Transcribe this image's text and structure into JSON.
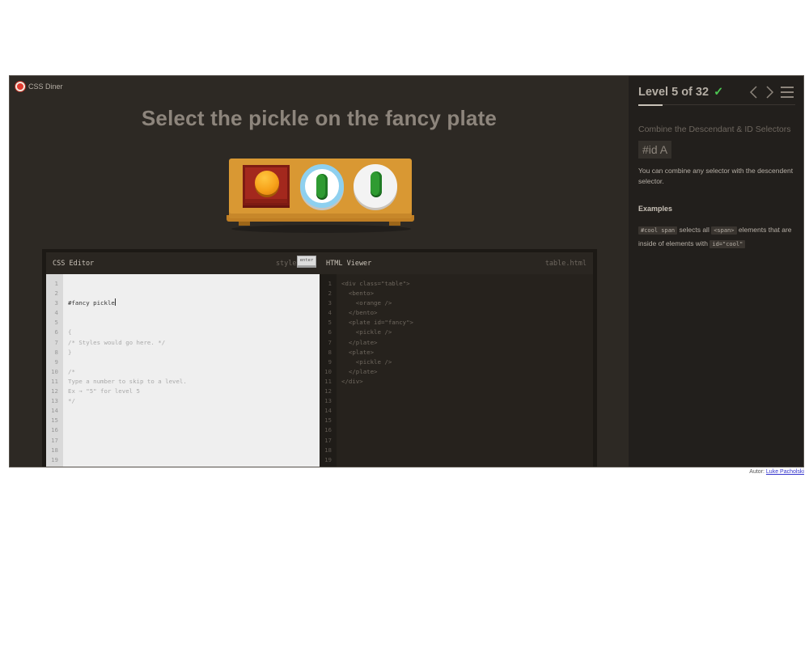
{
  "app": {
    "name": "CSS Diner"
  },
  "order": "Select the pickle on the fancy plate",
  "editor": {
    "css": {
      "title": "CSS Editor",
      "file": "style.css",
      "input": "#fancy pickle",
      "enter_label": "enter",
      "lines": [
        "{",
        "/* Styles would go here. */",
        "}",
        "",
        "/*",
        "Type a number to skip to a level.",
        "Ex → \"5\" for level 5",
        "*/"
      ]
    },
    "html": {
      "title": "HTML Viewer",
      "file": "table.html",
      "lines": [
        "<div class=\"table\">",
        "  <bento>",
        "    <orange />",
        "  </bento>",
        "  <plate id=\"fancy\">",
        "    <pickle />",
        "  </plate>",
        "  <plate>",
        "    <pickle />",
        "  </plate>",
        "</div>"
      ]
    },
    "line_numbers": [
      "1",
      "2",
      "3",
      "4",
      "5",
      "6",
      "7",
      "8",
      "9",
      "10",
      "11",
      "12",
      "13",
      "14",
      "15",
      "16",
      "17",
      "18",
      "19"
    ]
  },
  "sidebar": {
    "level_text": "Level 5 of 32",
    "check": "✓",
    "level_current": 5,
    "level_total": 32,
    "selector_name": "Combine the Descendant & ID Selectors",
    "syntax": "#id  A",
    "hint": "You can combine any selector with the descendent selector.",
    "examples_title": "Examples",
    "example": {
      "code1": "#cool span",
      "text1": " selects all ",
      "code2": "<span>",
      "text2": " elements that are inside of elements with ",
      "code3": "id=\"cool\""
    }
  },
  "author": {
    "label": "Autor: ",
    "name": "Luke Pacholski"
  },
  "colors": {
    "accent_check": "#4cc552",
    "background": "#2d2924",
    "sidebar": "#221f1c"
  }
}
